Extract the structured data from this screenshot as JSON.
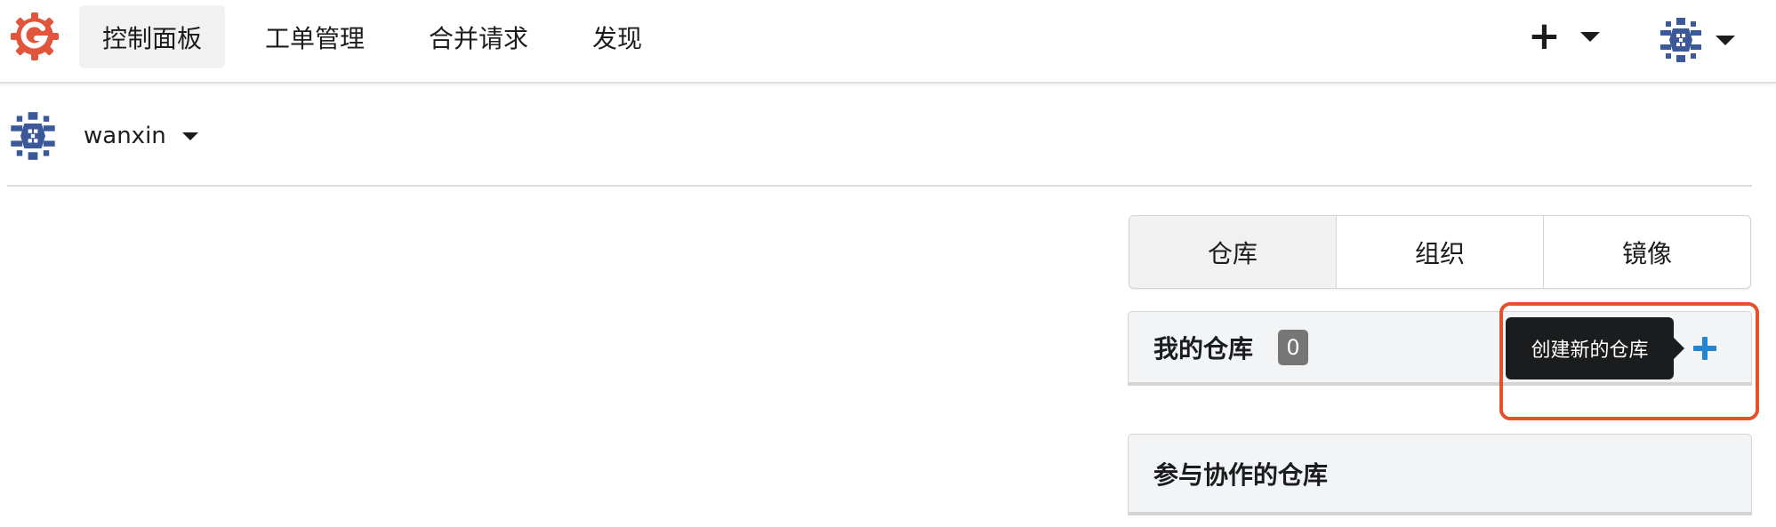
{
  "navbar": {
    "items": [
      {
        "label": "控制面板",
        "active": true
      },
      {
        "label": "工单管理",
        "active": false
      },
      {
        "label": "合并请求",
        "active": false
      },
      {
        "label": "发现",
        "active": false
      }
    ],
    "plus_icon": "plus-icon",
    "user_avatar_icon": "user-avatar"
  },
  "context": {
    "user_name": "wanxin"
  },
  "tabs": [
    {
      "label": "仓库",
      "active": true
    },
    {
      "label": "组织",
      "active": false
    },
    {
      "label": "镜像",
      "active": false
    }
  ],
  "my_repos": {
    "title": "我的仓库",
    "count": "0",
    "add_tooltip": "创建新的仓库"
  },
  "collab_repos": {
    "title": "参与协作的仓库"
  },
  "colors": {
    "logo": "#e0553c",
    "highlight": "#e0532d",
    "add_icon": "#2185d0",
    "avatar": "#3b5998"
  }
}
